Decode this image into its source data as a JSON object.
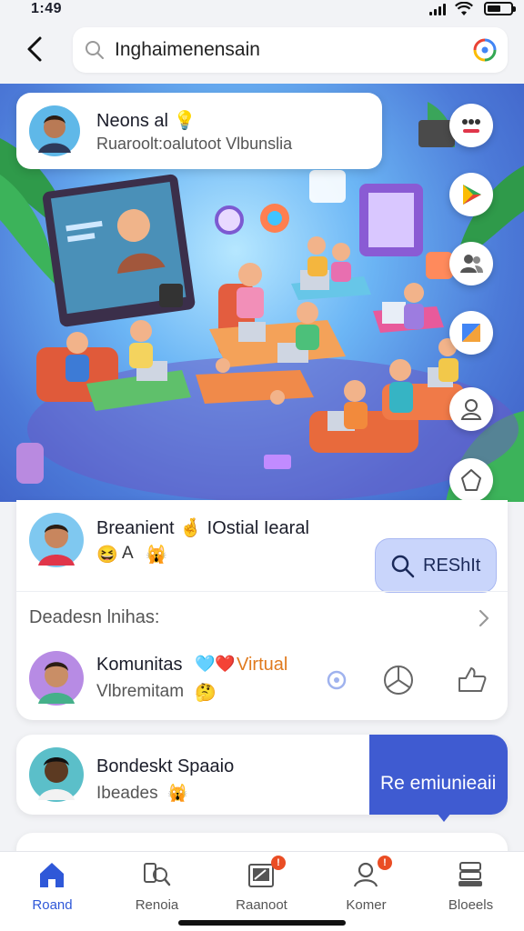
{
  "status_bar": {
    "time": "1:49"
  },
  "search": {
    "value": "Inghaimenensain"
  },
  "colors": {
    "accent": "#3f5bd1",
    "button_light": "#c9d5fb",
    "badge": "#ea4d24",
    "hero_bg": "#6cb6f5"
  },
  "hero": {
    "post": {
      "title": "Neons al 💡",
      "subtitle": "Ruaroolt:oalutoot Vlbunslia"
    },
    "side_actions": [
      "more-icon",
      "play-icon",
      "people-icon",
      "send-icon",
      "person-icon",
      "shape-icon"
    ],
    "carousel": {
      "count": 3,
      "active": 3
    }
  },
  "main_card": {
    "top_row": {
      "name": "Breanient 🤞 IOstial Iearal",
      "reactions": [
        "😆",
        "🙀"
      ],
      "tag_text": "A",
      "button_label": "REShIt"
    },
    "section_heading": "Deadesn lnihas:",
    "community": {
      "name": "Komunitas",
      "accent_name": "Virtual",
      "emoji_a": "🩵",
      "emoji_b": "❤️",
      "subtitle": "Vlbremitam",
      "subtitle_emoji": "🤔"
    }
  },
  "card2": {
    "name": "Bondeskt Spaaio",
    "subtitle": "Ibeades",
    "subtitle_emoji": "🙀",
    "cta_label": "Re emiunieaii"
  },
  "nav": {
    "items": [
      {
        "label": "Roand",
        "active": true
      },
      {
        "label": "Renoia",
        "badge": ""
      },
      {
        "label": "Raanoot",
        "badge": "!"
      },
      {
        "label": "Komer",
        "badge": "!"
      },
      {
        "label": "Bloeels",
        "badge": ""
      }
    ]
  }
}
